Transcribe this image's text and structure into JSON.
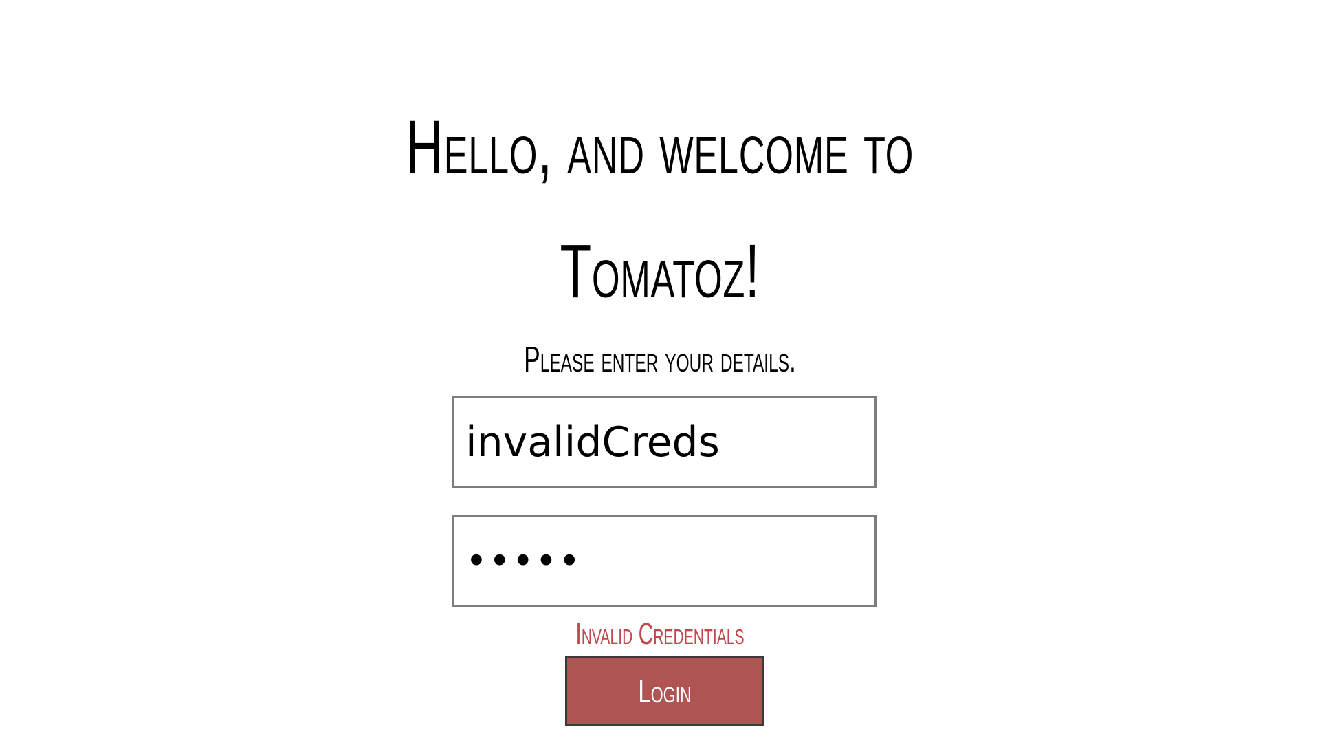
{
  "header": {
    "welcome_line1": "Hello, and welcome to",
    "welcome_line2": "Tomatoz!"
  },
  "form": {
    "subtitle": "Please enter your details.",
    "username_value": "invalidCreds",
    "password_value": "•••••",
    "error_message": "Invalid Credentials",
    "login_label": "Login"
  },
  "colors": {
    "accent": "#b05451",
    "error": "#c0474c",
    "border": "#7d7d7d"
  }
}
